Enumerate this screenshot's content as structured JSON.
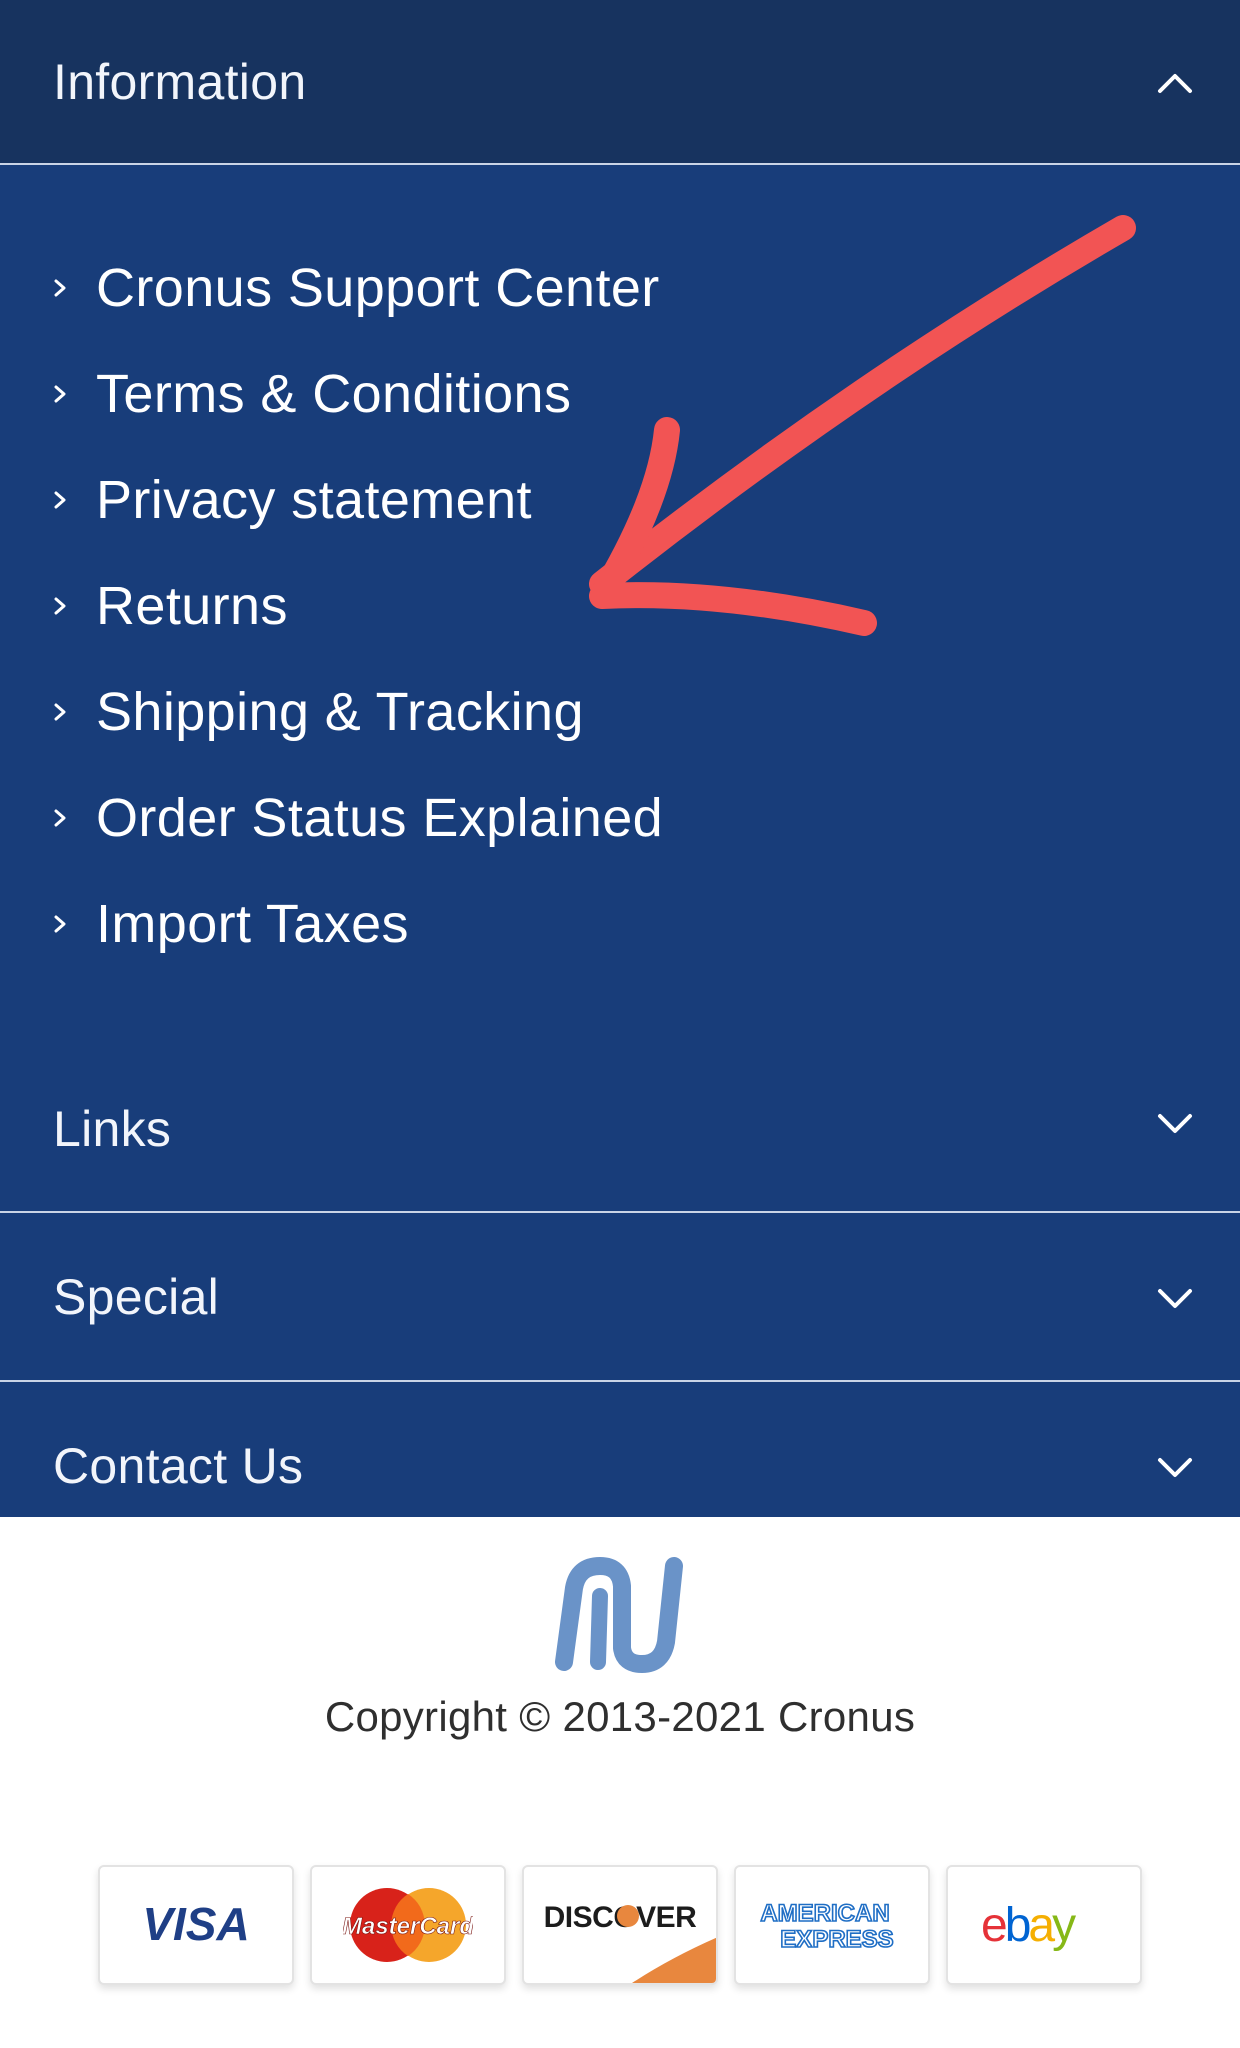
{
  "information": {
    "title": "Information",
    "expanded": true,
    "icon": "chevron-up-icon",
    "links": [
      "Cronus Support Center",
      "Terms & Conditions",
      "Privacy statement",
      "Returns",
      "Shipping & Tracking",
      "Order Status Explained",
      "Import Taxes"
    ]
  },
  "sections": [
    {
      "title": "Links",
      "icon": "chevron-down-icon"
    },
    {
      "title": "Special",
      "icon": "chevron-down-icon"
    },
    {
      "title": "Contact Us",
      "icon": "chevron-down-icon"
    }
  ],
  "annotation": {
    "icon": "red-arrow-icon",
    "color": "#f25454"
  },
  "footer": {
    "logo": "cronus-logo-icon",
    "copyright": "Copyright © 2013-2021 Cronus"
  },
  "payments": {
    "visa": "VISA",
    "mastercard": "MasterCard",
    "discover": "DISCOVER",
    "amex_line1": "AMERICAN",
    "amex_line2": "EXPRESS",
    "ebay_e": "e",
    "ebay_b": "b",
    "ebay_a": "a",
    "ebay_y": "y"
  },
  "colors": {
    "nav_bg": "#183d7a",
    "nav_header_bg": "#17335f",
    "text_light": "#ffffff",
    "divider": "#c9d4e6",
    "logo": "#6a93c8",
    "copyright_text": "#2f2f2f"
  }
}
